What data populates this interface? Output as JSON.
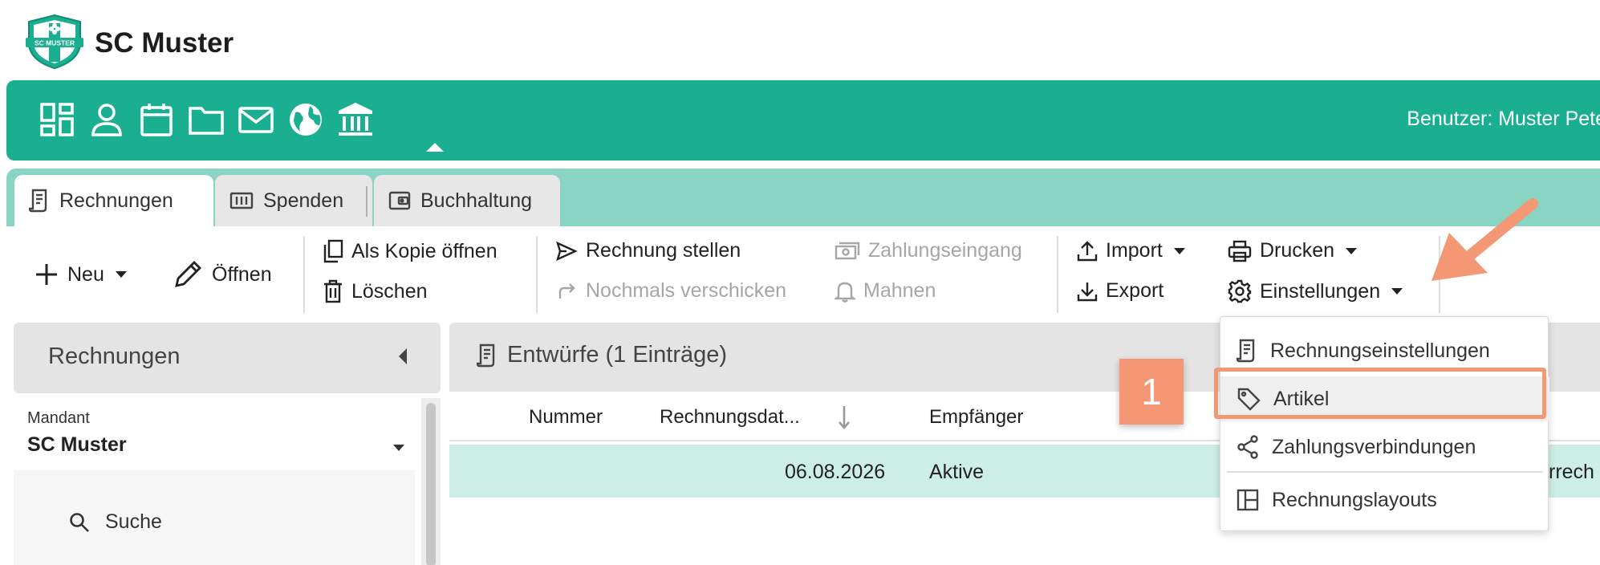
{
  "app": {
    "title": "SC Muster",
    "logo_text": "SC MUSTER"
  },
  "colors": {
    "brand": "#1baf92",
    "tabbar": "#89d4c3",
    "selected_row": "#cdeee6",
    "annotation": "#f39774"
  },
  "nav": {
    "icons": [
      "dashboard-icon",
      "person-icon",
      "calendar-icon",
      "folder-icon",
      "mail-icon",
      "globe-icon",
      "bank-icon"
    ],
    "active": "bank-icon",
    "user_label": "Benutzer: Muster Pete"
  },
  "tabs": [
    {
      "label": "Rechnungen",
      "icon": "invoice-icon",
      "active": true
    },
    {
      "label": "Spenden",
      "icon": "donation-icon",
      "active": false
    },
    {
      "label": "Buchhaltung",
      "icon": "wallet-icon",
      "active": false
    }
  ],
  "toolbar": {
    "new": "Neu",
    "open": "Öffnen",
    "open_copy": "Als Kopie öffnen",
    "delete": "Löschen",
    "issue_invoice": "Rechnung stellen",
    "resend": "Nochmals verschicken",
    "payment_receipt": "Zahlungseingang",
    "remind": "Mahnen",
    "import": "Import",
    "export": "Export",
    "print": "Drucken",
    "settings": "Einstellungen"
  },
  "sidebar": {
    "title": "Rechnungen",
    "mandant_label": "Mandant",
    "mandant_value": "SC Muster",
    "search_label": "Suche"
  },
  "main": {
    "title": "Entwürfe (1 Einträge)",
    "columns": [
      "Nummer",
      "Rechnungsdat...",
      "Empfänger"
    ],
    "sort": "descending",
    "rows": [
      {
        "nummer": "",
        "datum": "06.08.2026",
        "empfaenger": "Aktive",
        "trailing": "rrech"
      }
    ]
  },
  "dropdown": {
    "items": [
      {
        "label": "Rechnungseinstellungen",
        "icon": "invoice-icon"
      },
      {
        "label": "Artikel",
        "icon": "tag-icon"
      },
      {
        "label": "Zahlungsverbindungen",
        "icon": "share-icon"
      },
      {
        "label": "Rechnungslayouts",
        "icon": "layout-icon"
      }
    ]
  },
  "annotation": {
    "step": "1"
  }
}
